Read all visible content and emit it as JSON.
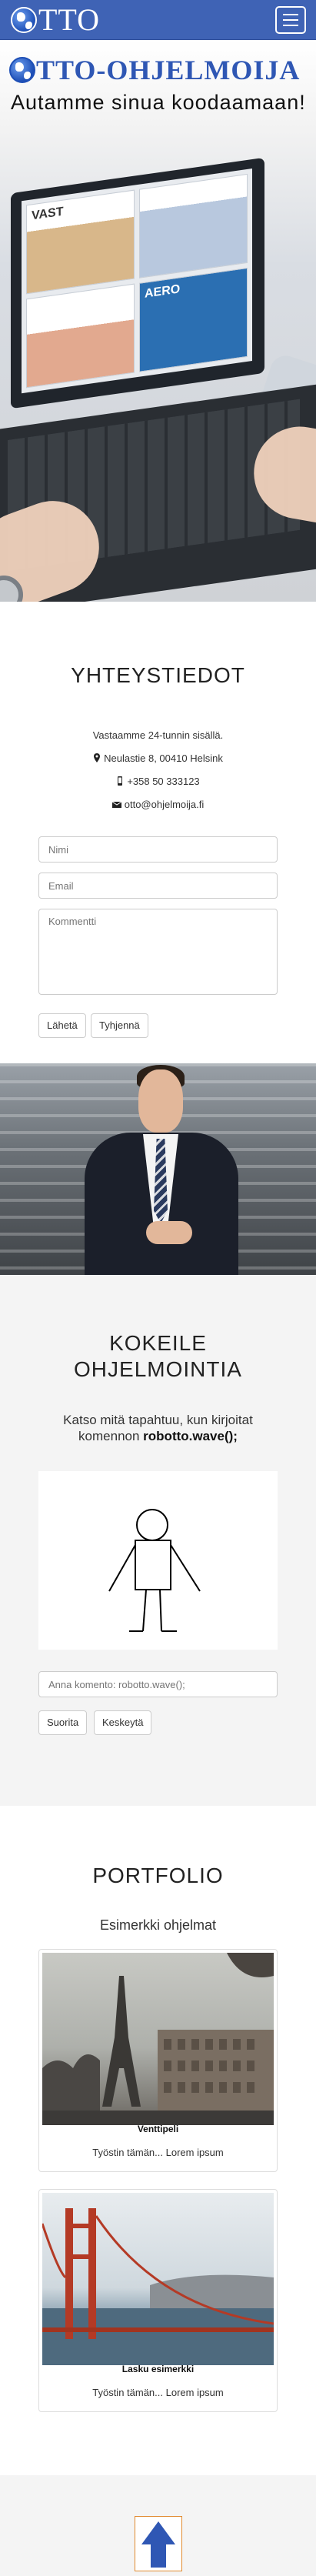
{
  "navbar": {
    "brand_text": "TTO",
    "menu_icon": "hamburger-icon"
  },
  "hero": {
    "title": "TTO-OHJELMOIJA",
    "subtitle": "Autamme sinua koodaamaan!",
    "laptop_tiles": [
      "VAST",
      "",
      "",
      "AERO"
    ]
  },
  "contact": {
    "heading": "YHTEYSTIEDOT",
    "hours": "Vastaamme 24-tunnin sisällä.",
    "address": "Neulastie 8, 00410 Helsink",
    "phone": "+358 50 333123",
    "email": "otto@ohjelmoija.fi",
    "name_placeholder": "Nimi",
    "email_placeholder": "Email",
    "comment_placeholder": "Kommentti",
    "send_label": "Lähetä",
    "clear_label": "Tyhjennä"
  },
  "try": {
    "heading_line1": "KOKEILE",
    "heading_line2": "OHJELMOINTIA",
    "desc_line1": "Katso mitä tapahtuu, kun kirjoitat",
    "desc_line2_prefix": "komennon ",
    "desc_command": "robotto.wave();",
    "input_placeholder": "Anna komento: robotto.wave();",
    "run_label": "Suorita",
    "stop_label": "Keskeytä"
  },
  "portfolio": {
    "heading": "PORTFOLIO",
    "subheading": "Esimerkki ohjelmat",
    "cards": [
      {
        "caption": "Venttipeli",
        "text": "Työstin tämän... Lorem ipsum"
      },
      {
        "caption": "Lasku esimerkki",
        "text": "Työstin tämän... Lorem ipsum"
      }
    ]
  },
  "footer": {
    "up_icon": "arrow-up-icon"
  },
  "colors": {
    "brand_blue": "#3f63b5",
    "title_blue": "#2f57b4",
    "section_gray": "#f4f4f4",
    "up_border": "#e08a2e"
  }
}
